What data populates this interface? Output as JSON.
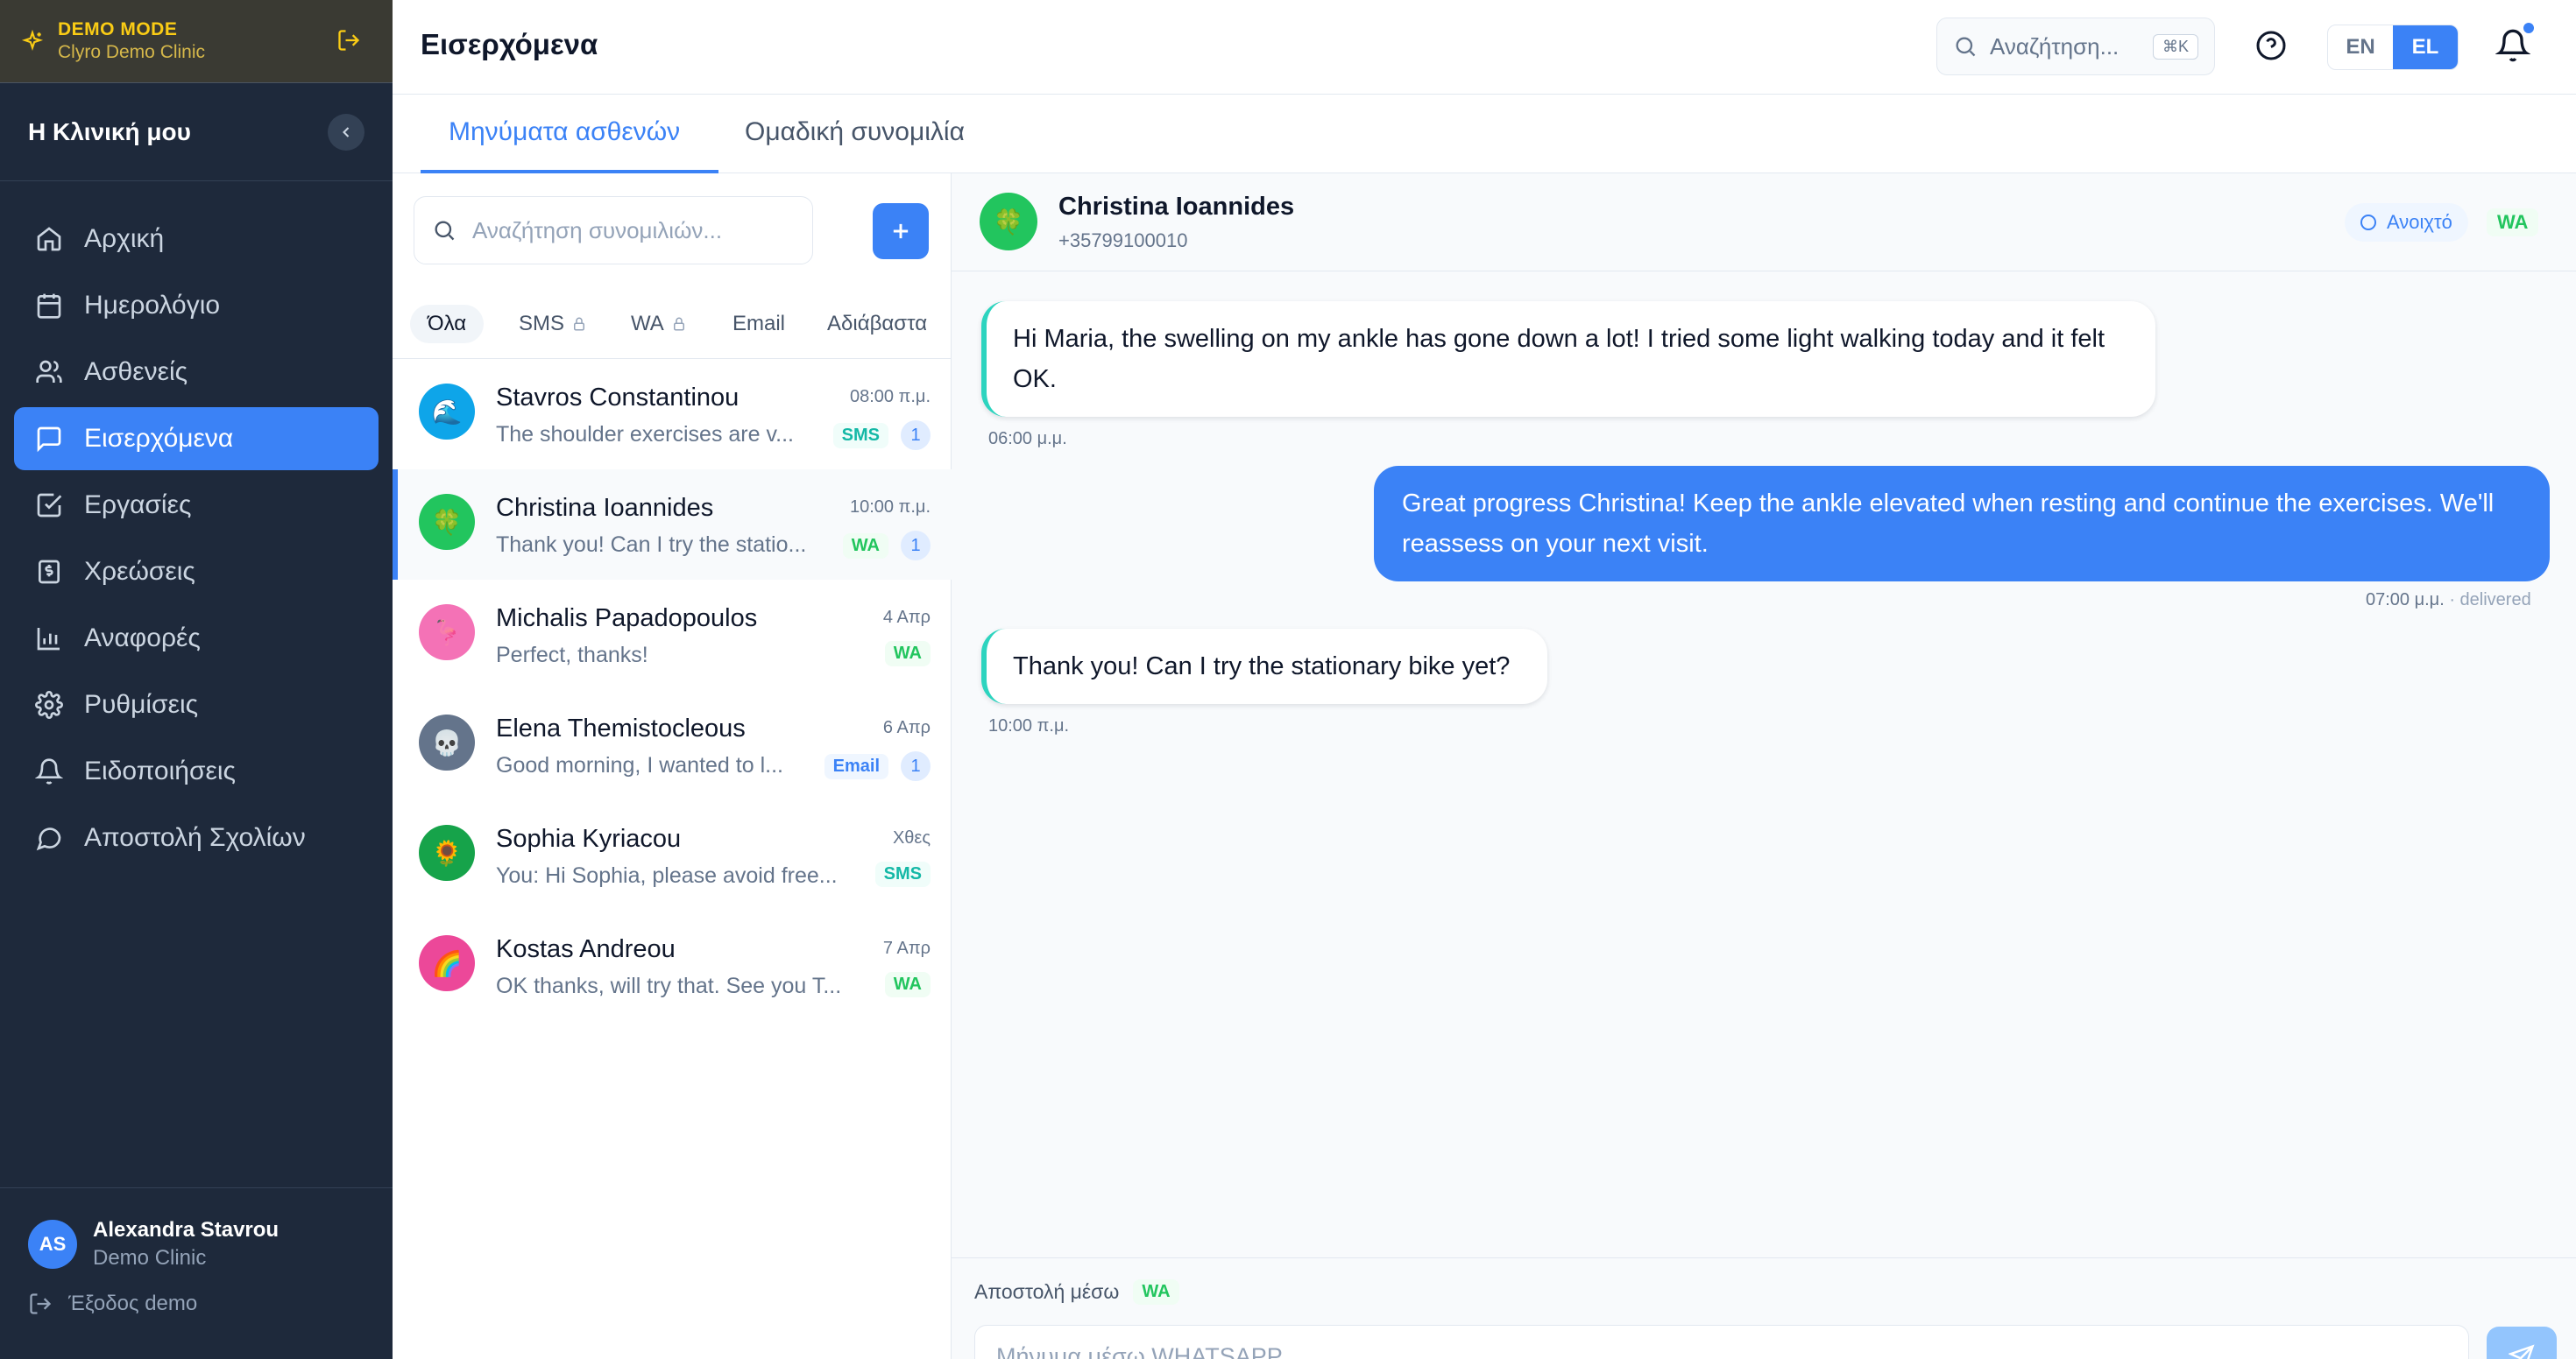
{
  "demo": {
    "title": "DEMO MODE",
    "subtitle": "Clyro Demo Clinic"
  },
  "sidebar": {
    "clinic_name": "Η Κλινική μου",
    "items": [
      {
        "label": "Αρχική",
        "icon": "home-icon"
      },
      {
        "label": "Ημερολόγιο",
        "icon": "calendar-icon"
      },
      {
        "label": "Ασθενείς",
        "icon": "users-icon"
      },
      {
        "label": "Εισερχόμενα",
        "icon": "message-square-icon",
        "active": true
      },
      {
        "label": "Εργασίες",
        "icon": "check-square-icon"
      },
      {
        "label": "Χρεώσεις",
        "icon": "dollar-receipt-icon"
      },
      {
        "label": "Αναφορές",
        "icon": "bar-chart-icon"
      },
      {
        "label": "Ρυθμίσεις",
        "icon": "gear-icon"
      },
      {
        "label": "Ειδοποιήσεις",
        "icon": "bell-icon"
      },
      {
        "label": "Αποστολή Σχολίων",
        "icon": "message-circle-icon"
      }
    ],
    "user": {
      "initials": "AS",
      "name": "Alexandra Stavrou",
      "clinic": "Demo Clinic"
    },
    "logout_label": "Έξοδος demo"
  },
  "header": {
    "title": "Εισερχόμενα",
    "search_placeholder": "Αναζήτηση...",
    "search_shortcut": "⌘K",
    "lang": {
      "en": "EN",
      "el": "EL",
      "selected": "EL"
    }
  },
  "tabs": [
    {
      "label": "Μηνύματα ασθενών",
      "active": true
    },
    {
      "label": "Ομαδική συνομιλία",
      "active": false
    }
  ],
  "conversations": {
    "search_placeholder": "Αναζήτηση συνομιλιών...",
    "filters": [
      "Όλα",
      "SMS",
      "WA",
      "Email",
      "Αδιάβαστα"
    ],
    "items": [
      {
        "avatar": "🌊",
        "avatar_color": "#0ea5e9",
        "name": "Stavros Constantinou",
        "time": "08:00 π.μ.",
        "preview": "The shoulder exercises are v...",
        "channel": "SMS",
        "unread": "1"
      },
      {
        "avatar": "🍀",
        "avatar_color": "#22c55e",
        "name": "Christina Ioannides",
        "time": "10:00 π.μ.",
        "preview": "Thank you! Can I try the statio...",
        "channel": "WA",
        "unread": "1",
        "selected": true
      },
      {
        "avatar": "🦩",
        "avatar_color": "#f472b6",
        "name": "Michalis Papadopoulos",
        "time": "4 Απρ",
        "preview": "Perfect, thanks!",
        "channel": "WA",
        "unread": ""
      },
      {
        "avatar": "💀",
        "avatar_color": "#64748b",
        "name": "Elena Themistocleous",
        "time": "6 Απρ",
        "preview": "Good morning, I wanted to l...",
        "channel": "Email",
        "unread": "1"
      },
      {
        "avatar": "🌻",
        "avatar_color": "#16a34a",
        "name": "Sophia Kyriacou",
        "time": "Χθες",
        "preview": "You: Hi Sophia, please avoid free...",
        "channel": "SMS",
        "unread": ""
      },
      {
        "avatar": "🌈",
        "avatar_color": "#ec4899",
        "name": "Kostas Andreou",
        "time": "7 Απρ",
        "preview": "OK thanks, will try that. See you T...",
        "channel": "WA",
        "unread": ""
      }
    ]
  },
  "chat": {
    "contact_name": "Christina Ioannides",
    "contact_phone": "+35799100010",
    "contact_avatar": "🍀",
    "status": "Ανοιχτό",
    "channel": "WA",
    "messages": [
      {
        "direction": "in",
        "text": "Hi Maria, the swelling on my ankle has gone down a lot! I tried some light walking today and it felt OK.",
        "time": "06:00 μ.μ."
      },
      {
        "direction": "out",
        "text": "Great progress Christina! Keep the ankle elevated when resting and continue the exercises. We'll reassess on your next visit.",
        "time": "07:00 μ.μ.",
        "status": "· delivered"
      },
      {
        "direction": "in",
        "text": "Thank you! Can I try the stationary bike yet?",
        "time": "10:00 π.μ."
      }
    ],
    "compose": {
      "via_label": "Αποστολή μέσω",
      "via_channel": "WA",
      "placeholder": "Μήνυμα μέσω WHATSAPP..."
    }
  }
}
